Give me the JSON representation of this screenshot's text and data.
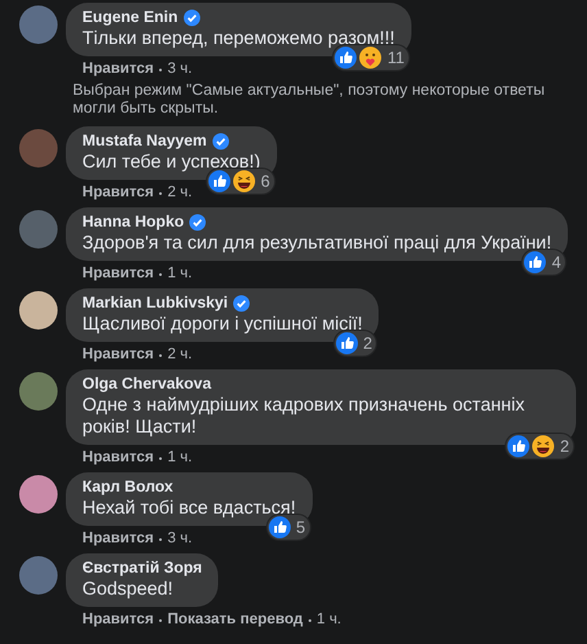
{
  "items": [
    {
      "kind": "comment",
      "name": "Eugene Enin",
      "verified": true,
      "text": "Тільки вперед, переможемо разом!!!",
      "reactions": [
        {
          "kind": "like"
        },
        {
          "kind": "care"
        }
      ],
      "count": "11",
      "actions": [
        "Нравится"
      ],
      "time": "3 ч."
    },
    {
      "kind": "notice",
      "text": "Выбран режим \"Самые актуальные\", поэтому некоторые ответы могли быть скрыты."
    },
    {
      "kind": "comment",
      "name": "Mustafa Nayyem",
      "verified": true,
      "text": "Сил тебе и успехов!)",
      "reactions": [
        {
          "kind": "like"
        },
        {
          "kind": "haha"
        }
      ],
      "count": "6",
      "actions": [
        "Нравится"
      ],
      "time": "2 ч."
    },
    {
      "kind": "comment",
      "name": "Hanna Hopko",
      "verified": true,
      "text": "Здоров'я та сил для результативної праці для України!",
      "reactions": [
        {
          "kind": "like"
        }
      ],
      "count": "4",
      "actions": [
        "Нравится"
      ],
      "time": "1 ч."
    },
    {
      "kind": "comment",
      "name": "Markian Lubkivskyi",
      "verified": true,
      "text": "Щасливої дороги і успішної місії!",
      "reactions": [
        {
          "kind": "like"
        }
      ],
      "count": "2",
      "actions": [
        "Нравится"
      ],
      "time": "2 ч."
    },
    {
      "kind": "comment",
      "name": "Olga Chervakova",
      "verified": false,
      "text": "Одне з наймудріших кадрових призначень останніх років! Щасти!",
      "reactions": [
        {
          "kind": "like"
        },
        {
          "kind": "haha"
        }
      ],
      "count": "2",
      "actions": [
        "Нравится"
      ],
      "time": "1 ч."
    },
    {
      "kind": "comment",
      "name": "Карл Волох",
      "verified": false,
      "text": "Нехай тобі все вдасться!",
      "reactions": [
        {
          "kind": "like"
        }
      ],
      "count": "5",
      "actions": [
        "Нравится"
      ],
      "time": "3 ч."
    },
    {
      "kind": "comment",
      "name": "Євстратій Зоря",
      "verified": false,
      "text": "Godspeed!",
      "actions": [
        "Нравится",
        "Показать перевод"
      ],
      "time": "1 ч."
    }
  ]
}
